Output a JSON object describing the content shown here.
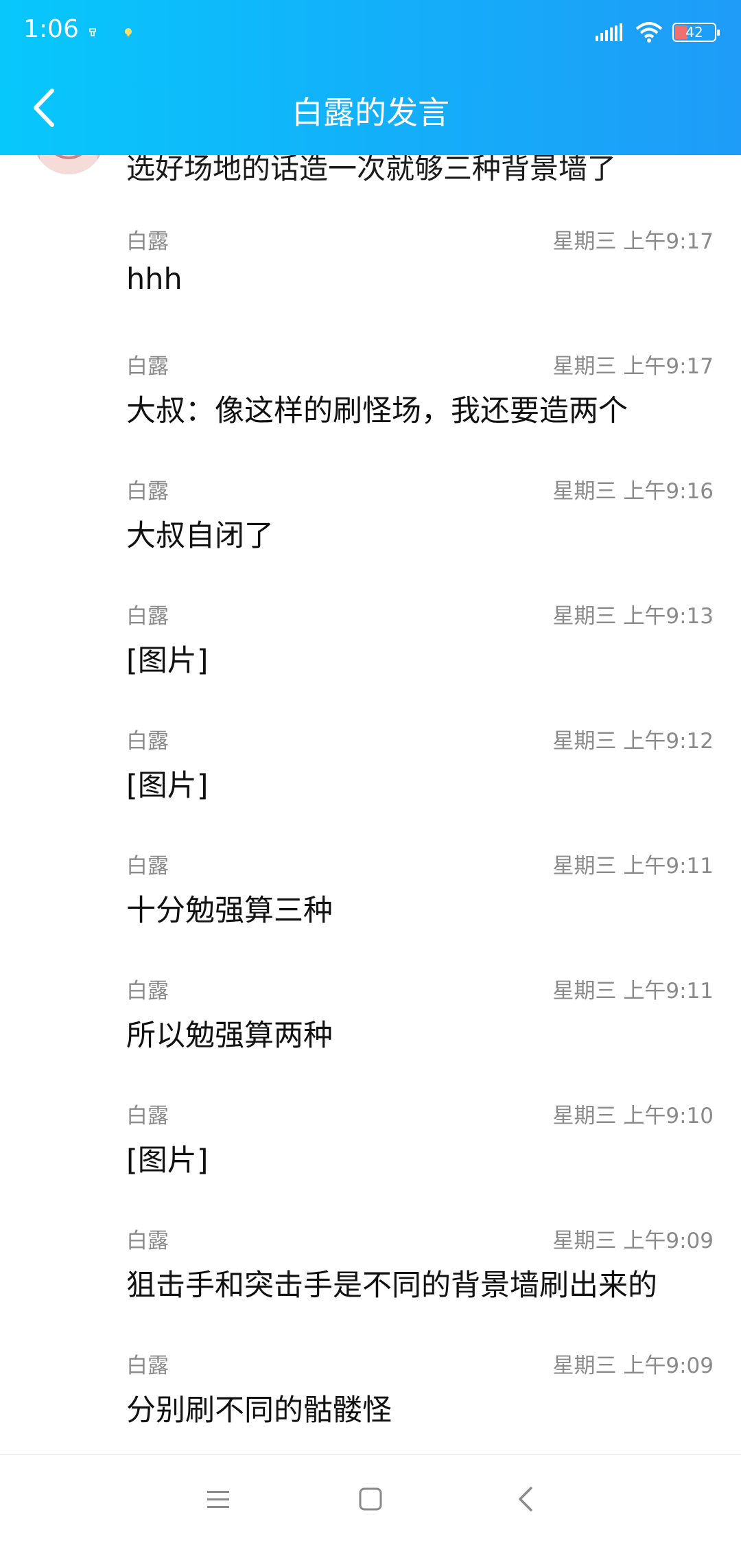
{
  "status_bar": {
    "time": "1:06",
    "battery": "42",
    "icons": [
      "usb-icon",
      "notification-icon",
      "signal-icon",
      "wifi-icon",
      "battery-icon"
    ]
  },
  "header": {
    "title": "白露的发言",
    "back_icon": "back-arrow-icon",
    "background": "#14aefa"
  },
  "partial_message": {
    "text": "选好场地的话造一次就够三种背景墙了"
  },
  "messages": [
    {
      "sender": "白露",
      "time": "星期三 上午9:17",
      "text": "hhh"
    },
    {
      "sender": "白露",
      "time": "星期三 上午9:17",
      "text": "大叔：像这样的刷怪场，我还要造两个"
    },
    {
      "sender": "白露",
      "time": "星期三 上午9:16",
      "text": "大叔自闭了"
    },
    {
      "sender": "白露",
      "time": "星期三 上午9:13",
      "text": "[图片]"
    },
    {
      "sender": "白露",
      "time": "星期三 上午9:12",
      "text": "[图片]"
    },
    {
      "sender": "白露",
      "time": "星期三 上午9:11",
      "text": "十分勉强算三种"
    },
    {
      "sender": "白露",
      "time": "星期三 上午9:11",
      "text": "所以勉强算两种"
    },
    {
      "sender": "白露",
      "time": "星期三 上午9:10",
      "text": "[图片]"
    },
    {
      "sender": "白露",
      "time": "星期三 上午9:09",
      "text": "狙击手和突击手是不同的背景墙刷出来的"
    },
    {
      "sender": "白露",
      "time": "星期三 上午9:09",
      "text": "分别刷不同的骷髅怪"
    }
  ],
  "nav_bar": {
    "icons": [
      "menu-icon",
      "home-icon",
      "back-icon"
    ]
  }
}
